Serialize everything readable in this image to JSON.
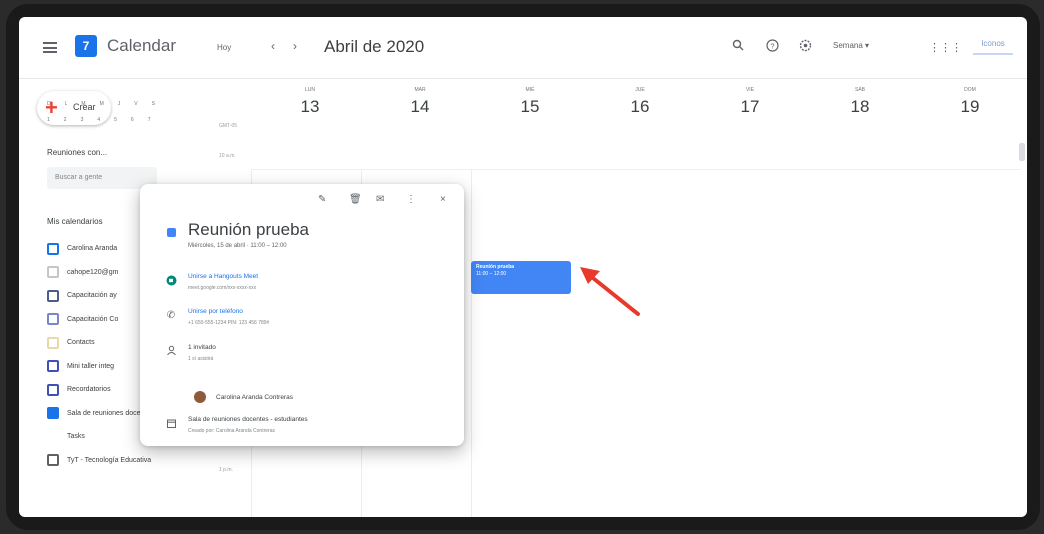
{
  "header": {
    "app_title": "Calendar",
    "logo_text": "7",
    "today_label": "Hoy",
    "month_title": "Abril de 2020",
    "view_label": "Semana ▾",
    "account_label": "Iconos"
  },
  "sidebar": {
    "create_label": "Crear",
    "mini_calendar_rows": [
      [
        "D",
        "L",
        "M",
        "M",
        "J",
        "V",
        "S"
      ],
      [
        "1",
        "2",
        "3",
        "4",
        "5",
        "6",
        "7"
      ]
    ],
    "people_title": "Reuniones con...",
    "people_placeholder": "Buscar a gente",
    "my_calendars_title": "Mis calendarios",
    "calendars": [
      {
        "label": "Carolina Aranda",
        "checked": false
      },
      {
        "label": "cahope120@gm",
        "checked": false
      },
      {
        "label": "Capacitación ay",
        "checked": false
      },
      {
        "label": "Capacitación Co",
        "checked": false
      },
      {
        "label": "Contacts",
        "checked": false
      },
      {
        "label": "Mini taller integ",
        "checked": false
      },
      {
        "label": "Recordatorios",
        "checked": false
      },
      {
        "label": "Sala de reuniones docente...",
        "checked": true
      },
      {
        "label": "Tasks",
        "checked": false
      },
      {
        "label": "TyT - Tecnología Educativa",
        "checked": false
      }
    ],
    "time_labels": [
      "GMT-05",
      "10 a.m.",
      "1 p.m."
    ]
  },
  "days": [
    {
      "abbr": "LUN",
      "num": "13"
    },
    {
      "abbr": "MAR",
      "num": "14"
    },
    {
      "abbr": "MIÉ",
      "num": "15"
    },
    {
      "abbr": "JUE",
      "num": "16"
    },
    {
      "abbr": "VIE",
      "num": "17"
    },
    {
      "abbr": "SÁB",
      "num": "18"
    },
    {
      "abbr": "DOM",
      "num": "19"
    }
  ],
  "event": {
    "title": "Reunión prueba",
    "time": "11:00 – 12:00"
  },
  "popup": {
    "title": "Reunión prueba",
    "date": "Miércoles, 15 de abril · 11:00 – 12:00",
    "meet_link": "Unirse a Hangouts Meet",
    "meet_url": "meet.google.com/xxx-xxxx-xxx",
    "phone_link": "Unirse por teléfono",
    "phone_number": "+1 650-555-1234 PIN: 123 456 789#",
    "guests_count": "1 invitado",
    "guests_status": "1 sí asistirá",
    "guest_name": "Carolina Aranda Contreras",
    "room": "Sala de reuniones docentes - estudiantes",
    "created_by": "Creado por: Carolina Aranda Contreras"
  },
  "colors": {
    "accent": "#1a73e8",
    "event": "#4285f4",
    "arrow": "#e8392b"
  }
}
